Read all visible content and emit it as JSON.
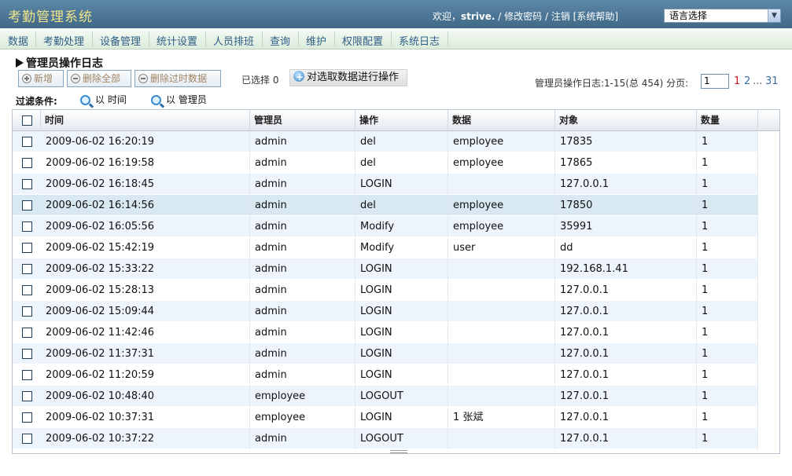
{
  "header": {
    "app_title": "考勤管理系统",
    "welcome": "欢迎，",
    "username": "strive.",
    "sep1": " / ",
    "change_password": "修改密码",
    "sep2": " / ",
    "logout": "注销",
    "help": " [系统帮助]",
    "language_select": "语言选择"
  },
  "nav": {
    "items": [
      "数据",
      "考勤处理",
      "设备管理",
      "统计设置",
      "人员排班",
      "查询",
      "维护",
      "权限配置",
      "系统日志"
    ]
  },
  "page": {
    "title": "管理员操作日志"
  },
  "toolbar": {
    "add_label": "新增",
    "delete_all_label": "删除全部",
    "delete_expired_label": "删除过时数据",
    "selected_label": "已选择 0",
    "apply_label": "对选取数据进行操作"
  },
  "pager": {
    "summary": "管理员操作日志:1-15(总 454)  分页:",
    "input_value": "1",
    "page_current": "1",
    "page_next": "2",
    "ellipsis": "...",
    "page_last": "31"
  },
  "filter": {
    "label": "过滤条件:",
    "by_time": "以 时间",
    "by_admin": "以 管理员"
  },
  "table": {
    "columns": [
      "时间",
      "管理员",
      "操作",
      "数据",
      "对象",
      "数量"
    ],
    "rows": [
      [
        "2009-06-02 16:20:19",
        "admin",
        "del",
        "employee",
        "17835",
        "1"
      ],
      [
        "2009-06-02 16:19:58",
        "admin",
        "del",
        "employee",
        "17865",
        "1"
      ],
      [
        "2009-06-02 16:18:45",
        "admin",
        "LOGIN",
        "",
        "127.0.0.1",
        "1"
      ],
      [
        "2009-06-02 16:14:56",
        "admin",
        "del",
        "employee",
        "17850",
        "1"
      ],
      [
        "2009-06-02 16:05:56",
        "admin",
        "Modify",
        "employee",
        "35991",
        "1"
      ],
      [
        "2009-06-02 15:42:19",
        "admin",
        "Modify",
        "user",
        "dd",
        "1"
      ],
      [
        "2009-06-02 15:33:22",
        "admin",
        "LOGIN",
        "",
        "192.168.1.41",
        "1"
      ],
      [
        "2009-06-02 15:28:13",
        "admin",
        "LOGIN",
        "",
        "127.0.0.1",
        "1"
      ],
      [
        "2009-06-02 15:09:44",
        "admin",
        "LOGIN",
        "",
        "127.0.0.1",
        "1"
      ],
      [
        "2009-06-02 11:42:46",
        "admin",
        "LOGIN",
        "",
        "127.0.0.1",
        "1"
      ],
      [
        "2009-06-02 11:37:31",
        "admin",
        "LOGIN",
        "",
        "127.0.0.1",
        "1"
      ],
      [
        "2009-06-02 11:20:59",
        "admin",
        "LOGIN",
        "",
        "127.0.0.1",
        "1"
      ],
      [
        "2009-06-02 10:48:40",
        "employee",
        "LOGOUT",
        "",
        "127.0.0.1",
        "1"
      ],
      [
        "2009-06-02 10:37:31",
        "employee",
        "LOGIN",
        "1 张斌",
        "127.0.0.1",
        "1"
      ],
      [
        "2009-06-02 10:37:22",
        "admin",
        "LOGOUT",
        "",
        "127.0.0.1",
        "1"
      ]
    ]
  }
}
